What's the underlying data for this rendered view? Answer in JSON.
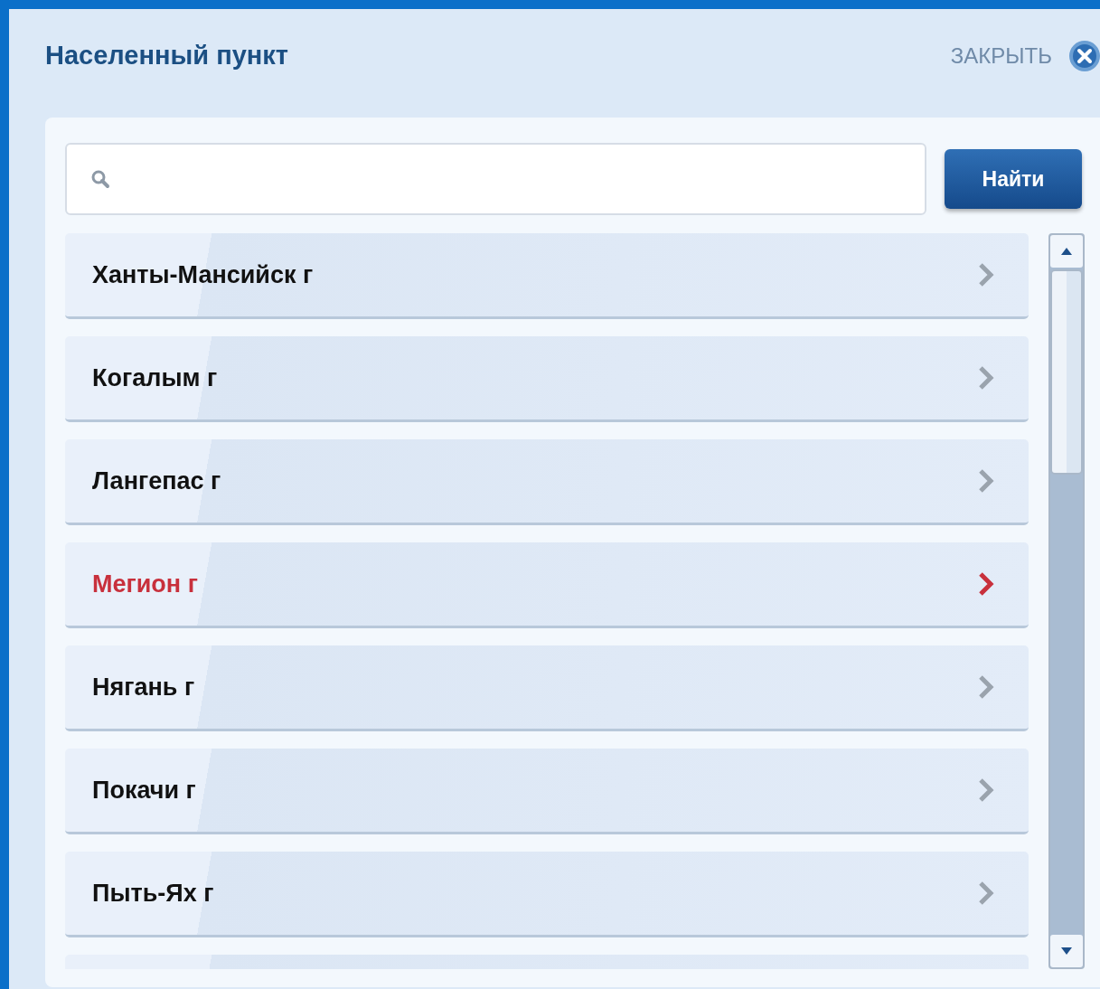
{
  "dialog": {
    "title": "Населенный пункт",
    "close_label": "ЗАКРЫТЬ"
  },
  "search": {
    "button": "Найти"
  },
  "items": [
    {
      "label": "Ханты-Мансийск г",
      "selected": false
    },
    {
      "label": "Когалым г",
      "selected": false
    },
    {
      "label": "Лангепас г",
      "selected": false
    },
    {
      "label": "Мегион г",
      "selected": true
    },
    {
      "label": "Нягань г",
      "selected": false
    },
    {
      "label": "Покачи г",
      "selected": false
    },
    {
      "label": "Пыть-Ях г",
      "selected": false
    }
  ]
}
